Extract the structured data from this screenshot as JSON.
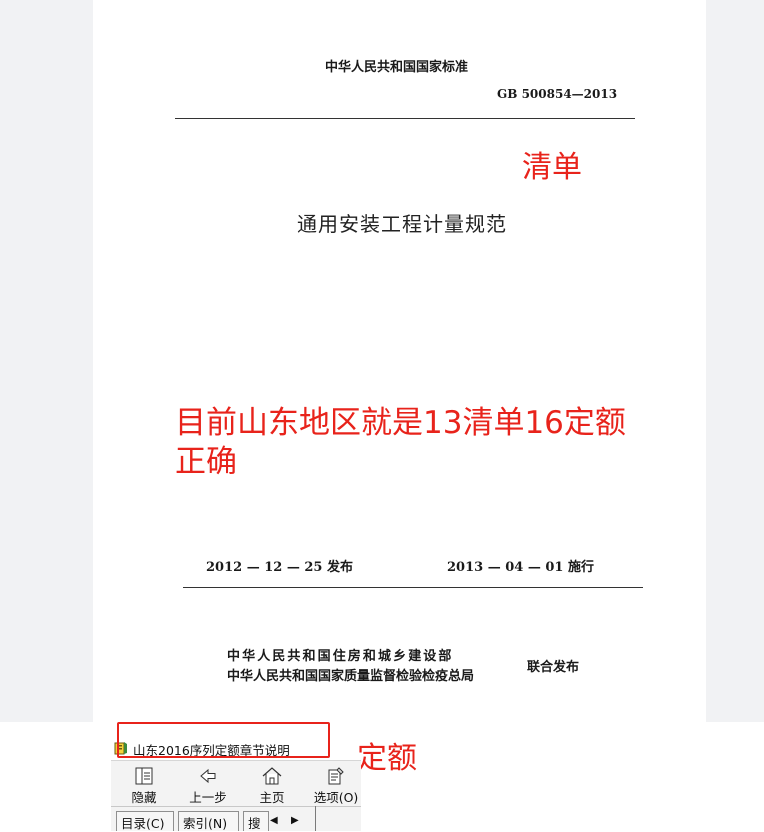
{
  "document": {
    "national_standard": "中华人民共和国国家标准",
    "standard_number": "GB 500854—2013",
    "title": "通用安装工程计量规范",
    "issue_date": "2012 — 12 — 25 发布",
    "implement_date": "2013 — 04 — 01 施行",
    "issuer_1": "中华人民共和国住房和城乡建设部",
    "issuer_2": "中华人民共和国国家质量监督检验检疫总局",
    "joint_release": "联合发布"
  },
  "annotations": {
    "qingdan": "清单",
    "main_line_1": "目前山东地区就是13清单16定额",
    "main_line_2": "正确",
    "dinge": "定额",
    "color": "#e8231b"
  },
  "help_window": {
    "title": "山东2016序列定额章节说明",
    "toolbar": {
      "hide": "隐藏",
      "back": "上一步",
      "home": "主页",
      "options": "选项(O)"
    },
    "tabs": {
      "contents": "目录(C)",
      "index": "索引(N)",
      "search": "搜"
    },
    "icons": [
      "help-book-icon",
      "hide-pane-icon",
      "back-arrow-icon",
      "home-icon",
      "options-icon",
      "scroll-left-icon",
      "scroll-right-icon"
    ]
  }
}
